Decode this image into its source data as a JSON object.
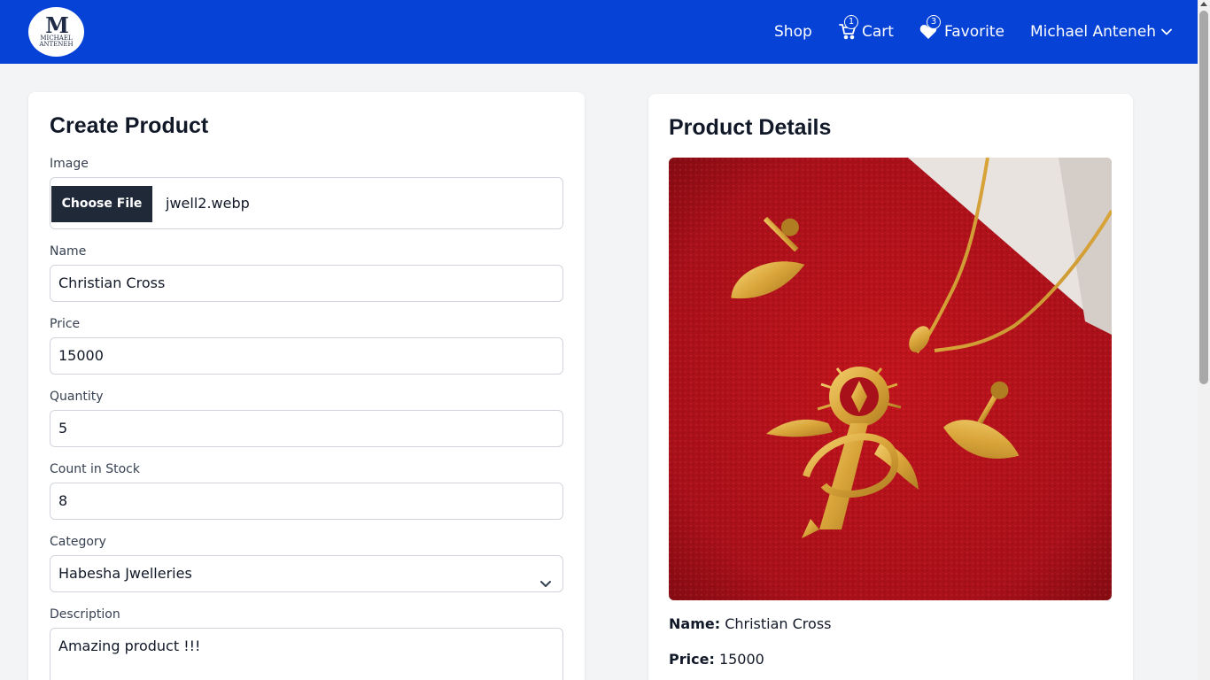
{
  "navbar": {
    "logo_mark": "M",
    "logo_text_line1": "MICHAEL",
    "logo_text_line2": "ANTENEH",
    "shop_label": "Shop",
    "cart_label": "Cart",
    "cart_count": "1",
    "favorite_label": "Favorite",
    "favorite_count": "3",
    "user_name": "Michael Anteneh",
    "bg_color": "#0642d6"
  },
  "create_form": {
    "title": "Create Product",
    "image_label": "Image",
    "choose_file_label": "Choose File",
    "file_name": "jwell2.webp",
    "name_label": "Name",
    "name_value": "Christian Cross",
    "price_label": "Price",
    "price_value": "15000",
    "quantity_label": "Quantity",
    "quantity_value": "5",
    "count_label": "Count in Stock",
    "count_value": "8",
    "category_label": "Category",
    "category_value": "Habesha Jwelleries",
    "description_label": "Description",
    "description_value": "Amazing product !!!"
  },
  "details": {
    "title": "Product Details",
    "name_label": "Name:",
    "name_value": "Christian Cross",
    "price_label": "Price:",
    "price_value": "15000"
  },
  "icons": {
    "cart": "cart-icon",
    "favorite": "heart-icon",
    "user_menu": "chevron-down-icon",
    "select": "chevron-down-icon"
  }
}
